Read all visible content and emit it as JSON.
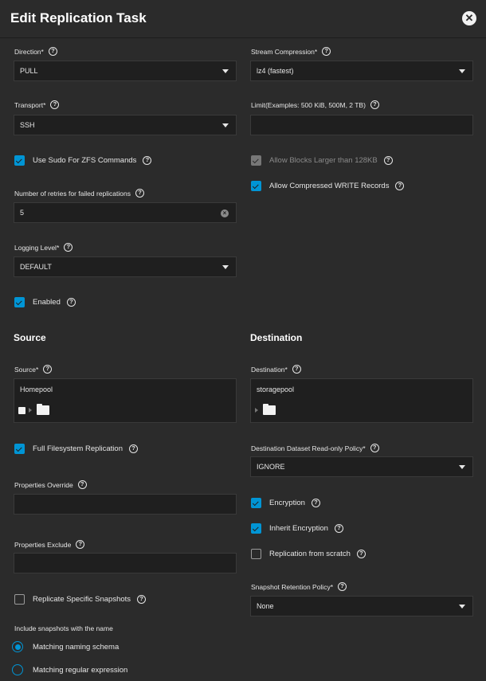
{
  "dialog": {
    "title": "Edit Replication Task",
    "close_glyph": "✕"
  },
  "help_glyph": "?",
  "left": {
    "direction": {
      "label": "Direction",
      "required": "*",
      "value": "PULL"
    },
    "transport": {
      "label": "Transport",
      "required": "*",
      "value": "SSH"
    },
    "use_sudo": {
      "label": "Use Sudo For ZFS Commands",
      "checked": true
    },
    "retries": {
      "label": "Number of retries for failed replications",
      "value": "5"
    },
    "logging": {
      "label": "Logging Level",
      "required": "*",
      "value": "DEFAULT"
    },
    "enabled": {
      "label": "Enabled",
      "checked": true
    }
  },
  "right": {
    "compression": {
      "label": "Stream Compression",
      "required": "*",
      "value": "lz4 (fastest)"
    },
    "limit": {
      "label": "Limit(Examples: 500 KiB, 500M, 2 TB)",
      "value": ""
    },
    "large_blocks": {
      "label": "Allow Blocks Larger than 128KB",
      "checked": true,
      "disabled": true
    },
    "compressed_write": {
      "label": "Allow Compressed WRITE Records",
      "checked": true
    }
  },
  "source": {
    "heading": "Source",
    "field_label": "Source",
    "required": "*",
    "value": "Homepool",
    "full_fs": {
      "label": "Full Filesystem Replication",
      "checked": true
    },
    "props_override": {
      "label": "Properties Override",
      "value": ""
    },
    "props_exclude": {
      "label": "Properties Exclude",
      "value": ""
    },
    "specific_snapshots": {
      "label": "Replicate Specific Snapshots",
      "checked": false
    },
    "include_label": "Include snapshots with the name",
    "radio_naming": {
      "label": "Matching naming schema",
      "selected": true
    },
    "radio_regex": {
      "label": "Matching regular expression",
      "selected": false
    }
  },
  "destination": {
    "heading": "Destination",
    "field_label": "Destination",
    "required": "*",
    "value": "storagepool",
    "readonly_policy": {
      "label": "Destination Dataset Read-only Policy",
      "required": "*",
      "value": "IGNORE"
    },
    "encryption": {
      "label": "Encryption",
      "checked": true
    },
    "inherit_encryption": {
      "label": "Inherit Encryption",
      "checked": true
    },
    "from_scratch": {
      "label": "Replication from scratch",
      "checked": false
    },
    "retention": {
      "label": "Snapshot Retention Policy",
      "required": "*",
      "value": "None"
    }
  },
  "colors": {
    "accent": "#0095d5",
    "background": "#2b2b2b",
    "field": "#1f1f1f"
  }
}
